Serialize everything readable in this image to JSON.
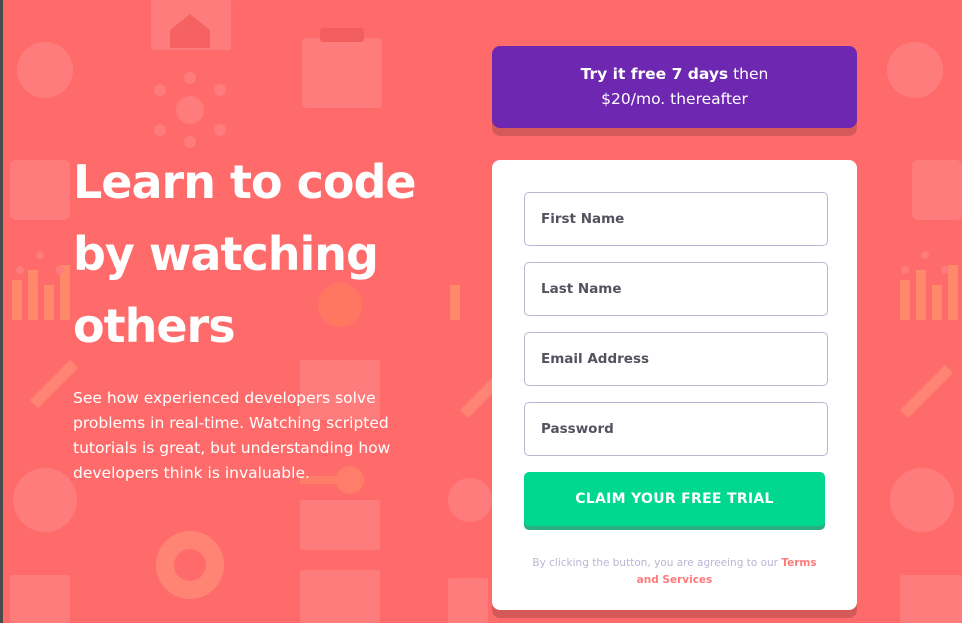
{
  "hero": {
    "title_line1": "Learn to code",
    "title_line2": "by watching",
    "title_line3": "others",
    "description": "See how experienced developers solve problems in real-time. Watching scripted tutorials is great, but understanding how developers think is invaluable."
  },
  "offer": {
    "highlight": "Try it free 7 days",
    "rest": " then",
    "line2": "$20/mo. thereafter"
  },
  "form": {
    "first_name_placeholder": "First Name",
    "last_name_placeholder": "Last Name",
    "email_placeholder": "Email Address",
    "password_placeholder": "Password",
    "first_name_value": "",
    "last_name_value": "",
    "email_value": "",
    "password_value": "",
    "submit_label": "Claim your free trial",
    "terms_prefix": "By clicking the button, you are agreeing to our ",
    "terms_link": "Terms and Services"
  },
  "colors": {
    "background": "#ff6b6b",
    "banner": "#6e27b0",
    "cta": "#00d890",
    "link": "#ff7a7a",
    "field_border": "#b9b6d3"
  },
  "icons": {
    "pattern": [
      "home-icon",
      "toolbox-icon",
      "molecule-icon",
      "thumbs-up-icon",
      "rocket-icon",
      "gear-icon",
      "lifebuoy-icon",
      "bar-chart-icon",
      "headset-icon",
      "key-icon",
      "browser-window-icon",
      "flag-icon"
    ]
  }
}
